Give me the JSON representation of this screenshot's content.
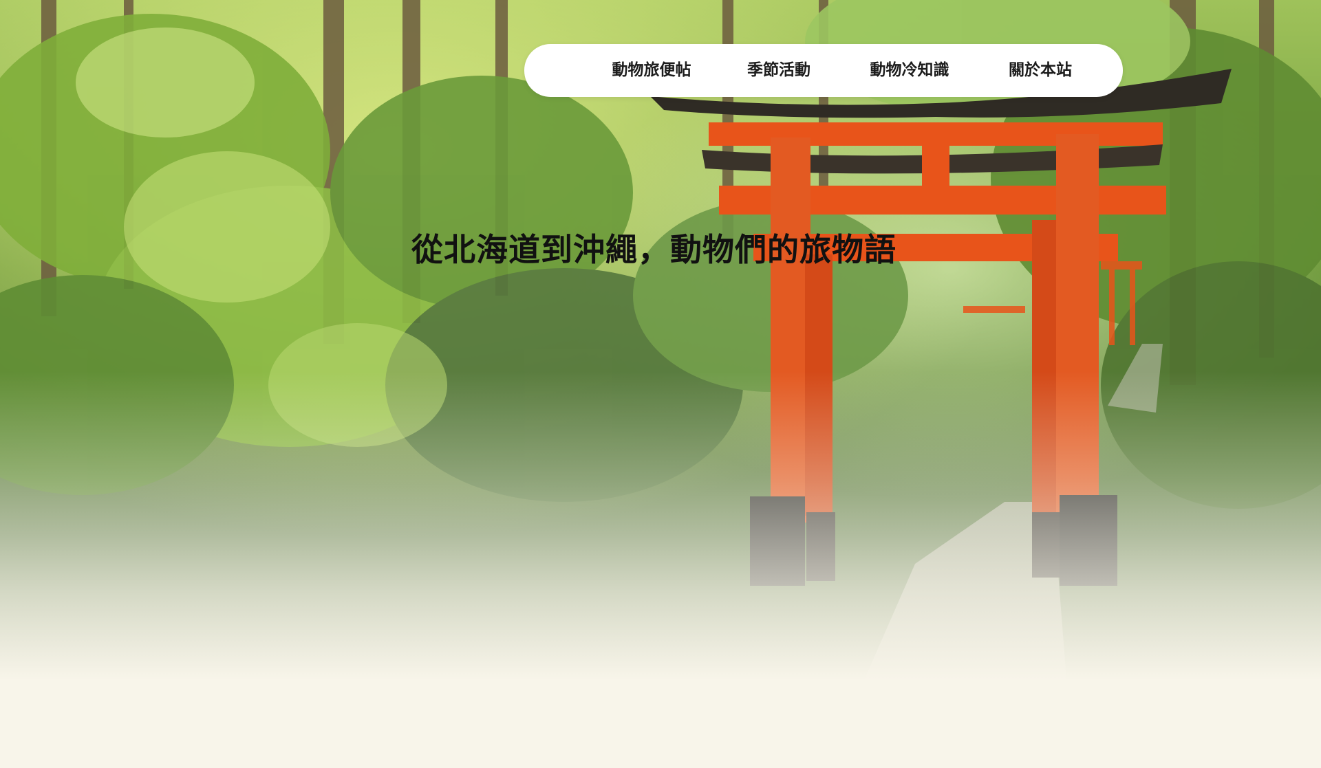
{
  "nav": {
    "items": [
      {
        "label": "動物旅便帖"
      },
      {
        "label": "季節活動"
      },
      {
        "label": "動物冷知識"
      },
      {
        "label": "關於本站"
      }
    ]
  },
  "hero": {
    "title": "從北海道到沖繩，動物們的旅物語",
    "image": "forest-path-with-red-torii-gates",
    "colors": {
      "torii": "#e8541a",
      "page_background": "#f8f5ea",
      "foliage": "#7fae3a"
    }
  }
}
